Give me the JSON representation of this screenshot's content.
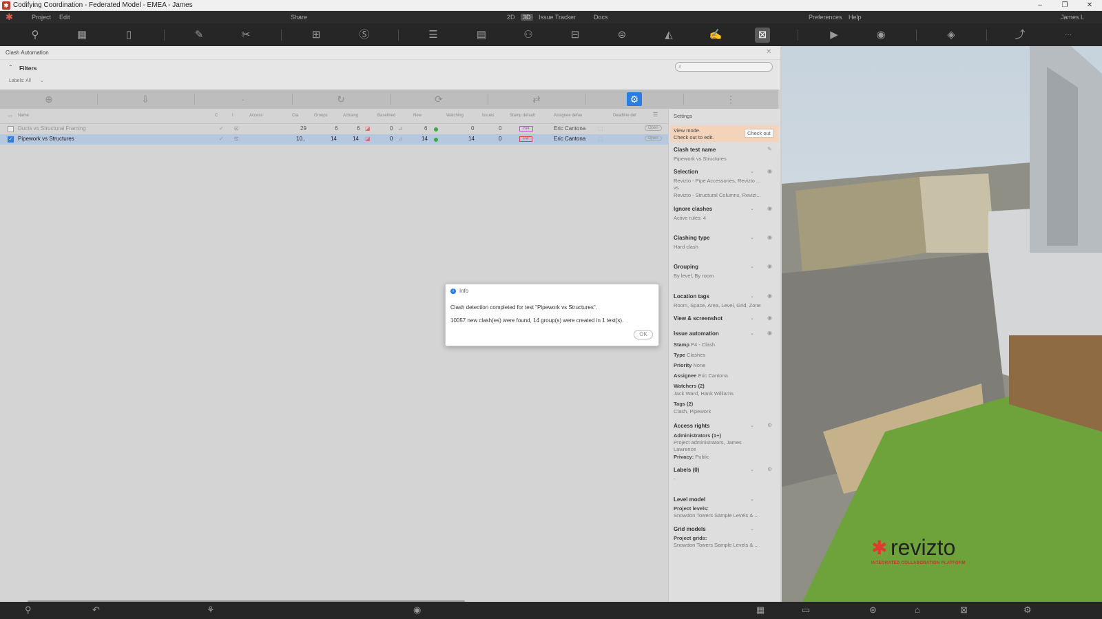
{
  "window": {
    "title": "Codifying Coordination - Federated Model - EMEA - James",
    "minimize": "–",
    "restore": "❐",
    "close": "✕"
  },
  "menu": {
    "items": [
      "Project",
      "Edit",
      "Share"
    ],
    "view_2d": "2D",
    "view_3d": "3D",
    "right_items": [
      "Issue Tracker",
      "Docs",
      "Preferences",
      "Help"
    ],
    "user": "James L",
    "more": "···"
  },
  "panel": {
    "title": "Clash Automation",
    "filters_label": "Filters",
    "labels_filter": "Labels: All",
    "search_placeholder": ""
  },
  "table": {
    "headers": [
      "Name",
      "C",
      "I",
      "Access",
      "Cla",
      "Groups",
      "Actuang",
      "Baselined",
      "New",
      "Watching",
      "Issues",
      "Stamp default",
      "Assignee defau",
      "Deadline def"
    ],
    "rows": [
      {
        "name": "Ducts vs Structural Framing",
        "clashes": "29",
        "groups": "6",
        "active": "6",
        "baseline": "0",
        "new": "6",
        "watching": "0",
        "issues": "0",
        "stamp": "M4",
        "assignee": "Eric Cantona",
        "open": "Open",
        "checked": false
      },
      {
        "name": "Pipework vs Structures",
        "clashes": "10..",
        "groups": "14",
        "active": "14",
        "baseline": "0",
        "new": "14",
        "watching": "14",
        "issues": "0",
        "stamp": "P4",
        "assignee": "Eric Cantona",
        "open": "Open",
        "checked": true
      }
    ]
  },
  "settings": {
    "title": "Settings",
    "view_mode": "View mode.",
    "check_out_to_edit": "Check out to edit.",
    "check_out_btn": "Check out",
    "clash_test_name_label": "Clash test name",
    "clash_test_name": "Pipework vs Structures",
    "selection_label": "Selection",
    "selection_a": "Revizto - Pipe Accessories, Revizto ...",
    "selection_vs": "vs",
    "selection_b": "Revizto - Structural Columns, Revizt...",
    "ignore_label": "Ignore clashes",
    "ignore_value": "Active rules: 4",
    "clashing_type_label": "Clashing type",
    "clashing_type_value": "Hard clash",
    "grouping_label": "Grouping",
    "grouping_value": "By level, By room",
    "location_label": "Location tags",
    "location_value": "Room, Space, Area, Level, Grid, Zone",
    "view_screenshot_label": "View & screenshot",
    "issue_automation_label": "Issue automation",
    "stamp_key": "Stamp",
    "stamp_value": "P4 - Clash",
    "type_key": "Type",
    "type_value": "Clashes",
    "priority_key": "Priority",
    "priority_value": "None",
    "assignee_key": "Assignee",
    "assignee_value": "Eric Cantona",
    "watchers_label": "Watchers (2)",
    "watchers_value": "Jack Ward, Hank Williams",
    "tags_label": "Tags (2)",
    "tags_value": "Clash, Pipework",
    "access_label": "Access rights",
    "admins_label": "Administrators (1+)",
    "admins_value": "Project administrators, James",
    "admins_value2": "Lawrence",
    "privacy_key": "Privacy:",
    "privacy_value": "Public",
    "labels_label": "Labels (0)",
    "labels_value": "-",
    "level_model_label": "Level model",
    "project_levels_label": "Project levels:",
    "project_levels_value": "Snowdon Towers Sample Levels & ...",
    "grid_models_label": "Grid models",
    "project_grids_label": "Project grids:",
    "project_grids_value": "Snowdon Towers Sample Levels & ..."
  },
  "dialog": {
    "title": "Info",
    "line1": "Clash detection completed for test \"Pipework vs Structures\".",
    "line2": "10057 new clash(es) were found, 14 group(s) were created in 1 test(s).",
    "ok": "OK"
  },
  "brand": {
    "name": "revizto",
    "tagline": "INTEGRATED COLLABORATION PLATFORM"
  },
  "colors": {
    "accent": "#2a7de1",
    "brand": "#e03a2f",
    "status_green": "#3aa845"
  }
}
